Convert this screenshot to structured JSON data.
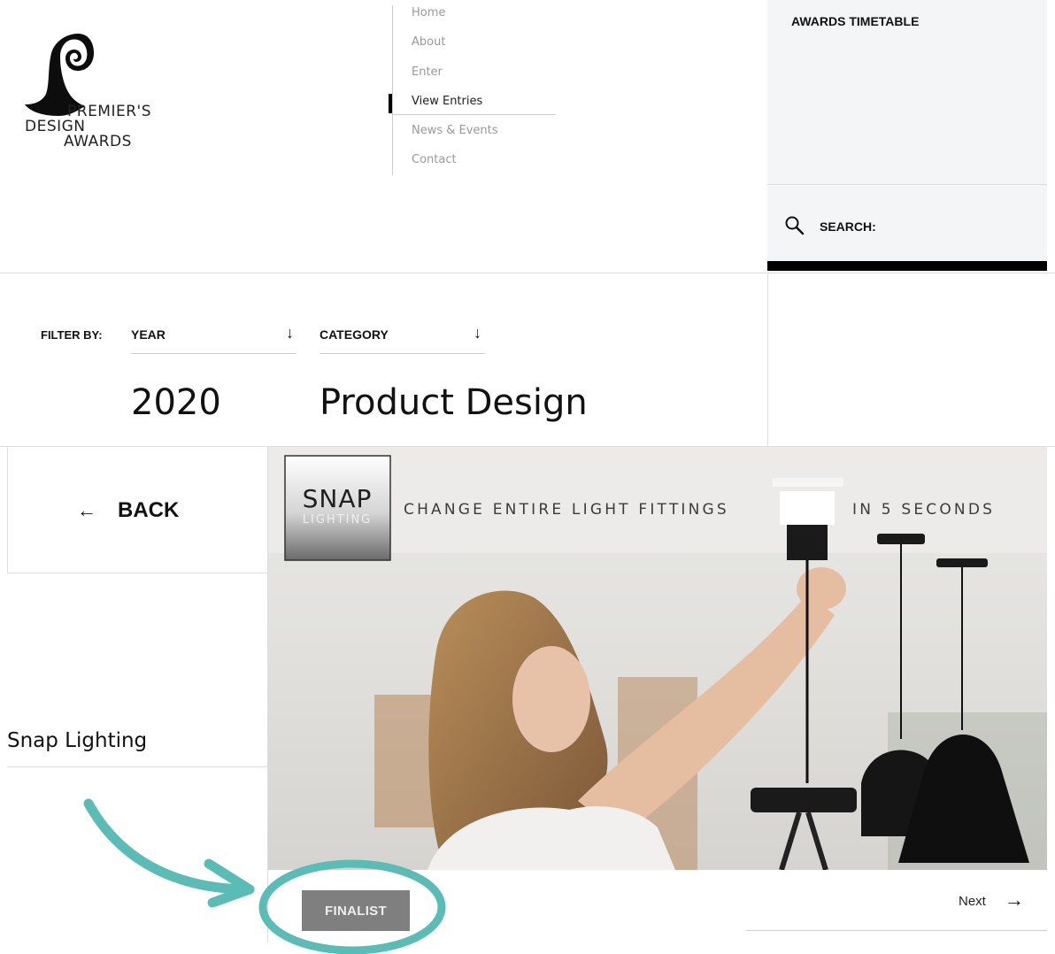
{
  "header": {
    "logo_text": [
      "PREMIER'S",
      "DESIGN",
      "AWARDS"
    ],
    "nav": [
      {
        "label": "Home",
        "active": false
      },
      {
        "label": "About",
        "active": false
      },
      {
        "label": "Enter",
        "active": false
      },
      {
        "label": "View Entries",
        "active": true
      },
      {
        "label": "News & Events",
        "active": false
      },
      {
        "label": "Contact",
        "active": false
      }
    ],
    "timetable_label": "AWARDS TIMETABLE",
    "search_label": "SEARCH:",
    "search_icon": "search-icon"
  },
  "filter": {
    "label": "FILTER BY:",
    "year_label": "YEAR",
    "category_label": "CATEGORY",
    "year_value": "2020",
    "category_value": "Product Design",
    "dropdown_icon": "arrow-down-icon"
  },
  "entry": {
    "back_label": "BACK",
    "back_icon": "arrow-left-icon",
    "title": "Snap Lighting",
    "badge": "FINALIST",
    "next_label": "Next",
    "next_icon": "arrow-right-icon"
  },
  "hero": {
    "brand_top": "SNAP",
    "brand_bottom": "LIGHTING",
    "tagline_left": "CHANGE ENTIRE LIGHT FITTINGS",
    "tagline_right": "IN 5 SECONDS"
  },
  "colors": {
    "annotation": "#5bbcb6",
    "badge": "#7f7f7f",
    "panel": "#f4f5f6"
  }
}
